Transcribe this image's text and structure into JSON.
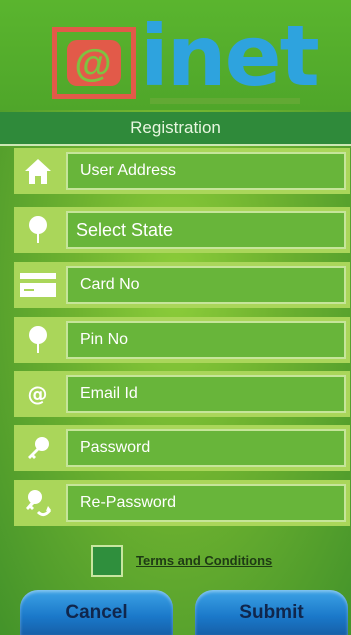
{
  "app": {
    "logo_text": "inet",
    "screen_title": "Registration"
  },
  "form": {
    "fields": [
      {
        "label": "User Address",
        "icon": "home-icon"
      },
      {
        "label": "Select State",
        "icon": "map-pin-icon"
      },
      {
        "label": "Card No",
        "icon": "credit-card-icon"
      },
      {
        "label": "Pin No",
        "icon": "pin-icon"
      },
      {
        "label": "Email Id",
        "icon": "at-icon"
      },
      {
        "label": "Password",
        "icon": "key-icon"
      },
      {
        "label": "Re-Password",
        "icon": "key-refresh-icon"
      }
    ],
    "terms_label": "Terms and Conditions",
    "terms_checked": false
  },
  "actions": {
    "cancel_label": "Cancel",
    "submit_label": "Submit"
  },
  "colors": {
    "background": "#6fb330",
    "row_bg": "#aad65a",
    "field_bg": "#68b53a",
    "header_bar": "#2f8a3a",
    "button": "#1a78c9",
    "logo_red": "#e25a49",
    "logo_blue": "#2ea3de"
  }
}
